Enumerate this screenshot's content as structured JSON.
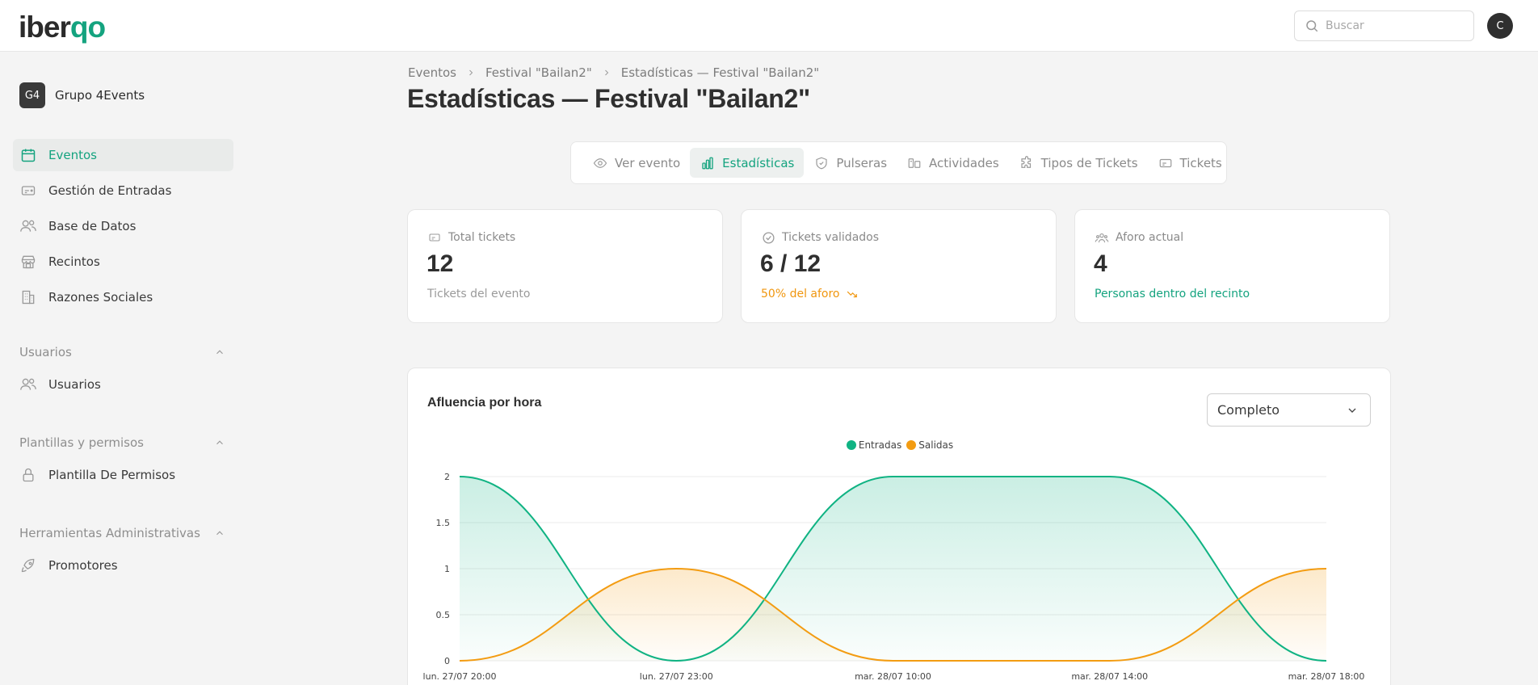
{
  "app": {
    "logo_prefix": "iber",
    "logo_accent": "qo",
    "brand_color": "#14a37f",
    "user_initial": "C"
  },
  "search": {
    "placeholder": "Buscar"
  },
  "sidebar": {
    "org_badge": "G4",
    "org_name": "Grupo 4Events",
    "items": [
      {
        "label": "Eventos",
        "icon": "calendar-icon",
        "active": true
      },
      {
        "label": "Gestión de Entradas",
        "icon": "ticket-icon",
        "active": false
      },
      {
        "label": "Base de Datos",
        "icon": "users-icon",
        "active": false
      },
      {
        "label": "Recintos",
        "icon": "store-icon",
        "active": false
      },
      {
        "label": "Razones Sociales",
        "icon": "building-icon",
        "active": false
      }
    ],
    "sections": [
      {
        "title": "Usuarios",
        "items": [
          {
            "label": "Usuarios",
            "icon": "users-icon"
          }
        ]
      },
      {
        "title": "Plantillas y permisos",
        "items": [
          {
            "label": "Plantilla De Permisos",
            "icon": "lock-icon"
          }
        ]
      },
      {
        "title": "Herramientas Administrativas",
        "items": [
          {
            "label": "Promotores",
            "icon": "rocket-icon"
          }
        ]
      }
    ]
  },
  "breadcrumb": [
    "Eventos",
    "Festival \"Bailan2\"",
    "Estadísticas — Festival \"Bailan2\""
  ],
  "page_title": "Estadísticas — Festival \"Bailan2\"",
  "tabs": [
    {
      "label": "Ver evento",
      "icon": "eye-icon",
      "active": false
    },
    {
      "label": "Estadísticas",
      "icon": "bar-chart-icon",
      "active": true
    },
    {
      "label": "Pulseras",
      "icon": "shield-check-icon",
      "active": false
    },
    {
      "label": "Actividades",
      "icon": "activities-icon",
      "active": false
    },
    {
      "label": "Tipos de Tickets",
      "icon": "puzzle-icon",
      "active": false
    },
    {
      "label": "Tickets",
      "icon": "ticket-icon",
      "active": false
    }
  ],
  "stats": {
    "total": {
      "label": "Total tickets",
      "value": "12",
      "sub": "Tickets del evento",
      "icon": "ticket-icon"
    },
    "validated": {
      "label": "Tickets validados",
      "value": "6 / 12",
      "sub": "50% del aforo",
      "icon": "check-circle-icon",
      "sub_color": "#f0960e"
    },
    "capacity": {
      "label": "Aforo actual",
      "value": "4",
      "sub": "Personas dentro del recinto",
      "icon": "people-group-icon",
      "sub_color": "#14a37f"
    }
  },
  "chart": {
    "title": "Afluencia por hora",
    "range_selected": "Completo"
  },
  "chart_data": {
    "type": "area",
    "title": "Afluencia por hora",
    "x": [
      "lun. 27/07 20:00",
      "lun. 27/07 23:00",
      "mar. 28/07 10:00",
      "mar. 28/07 14:00",
      "mar. 28/07 18:00"
    ],
    "series": [
      {
        "name": "Entradas",
        "color": "#10b383",
        "values": [
          2,
          0,
          2,
          2,
          0
        ]
      },
      {
        "name": "Salidas",
        "color": "#f39c12",
        "values": [
          0,
          1,
          0,
          0,
          1
        ]
      }
    ],
    "y_ticks": [
      "0",
      "0.5",
      "1",
      "1.5",
      "2"
    ],
    "ylim": [
      0,
      2
    ],
    "grid": true,
    "legend": "top-center",
    "smooth": true
  }
}
